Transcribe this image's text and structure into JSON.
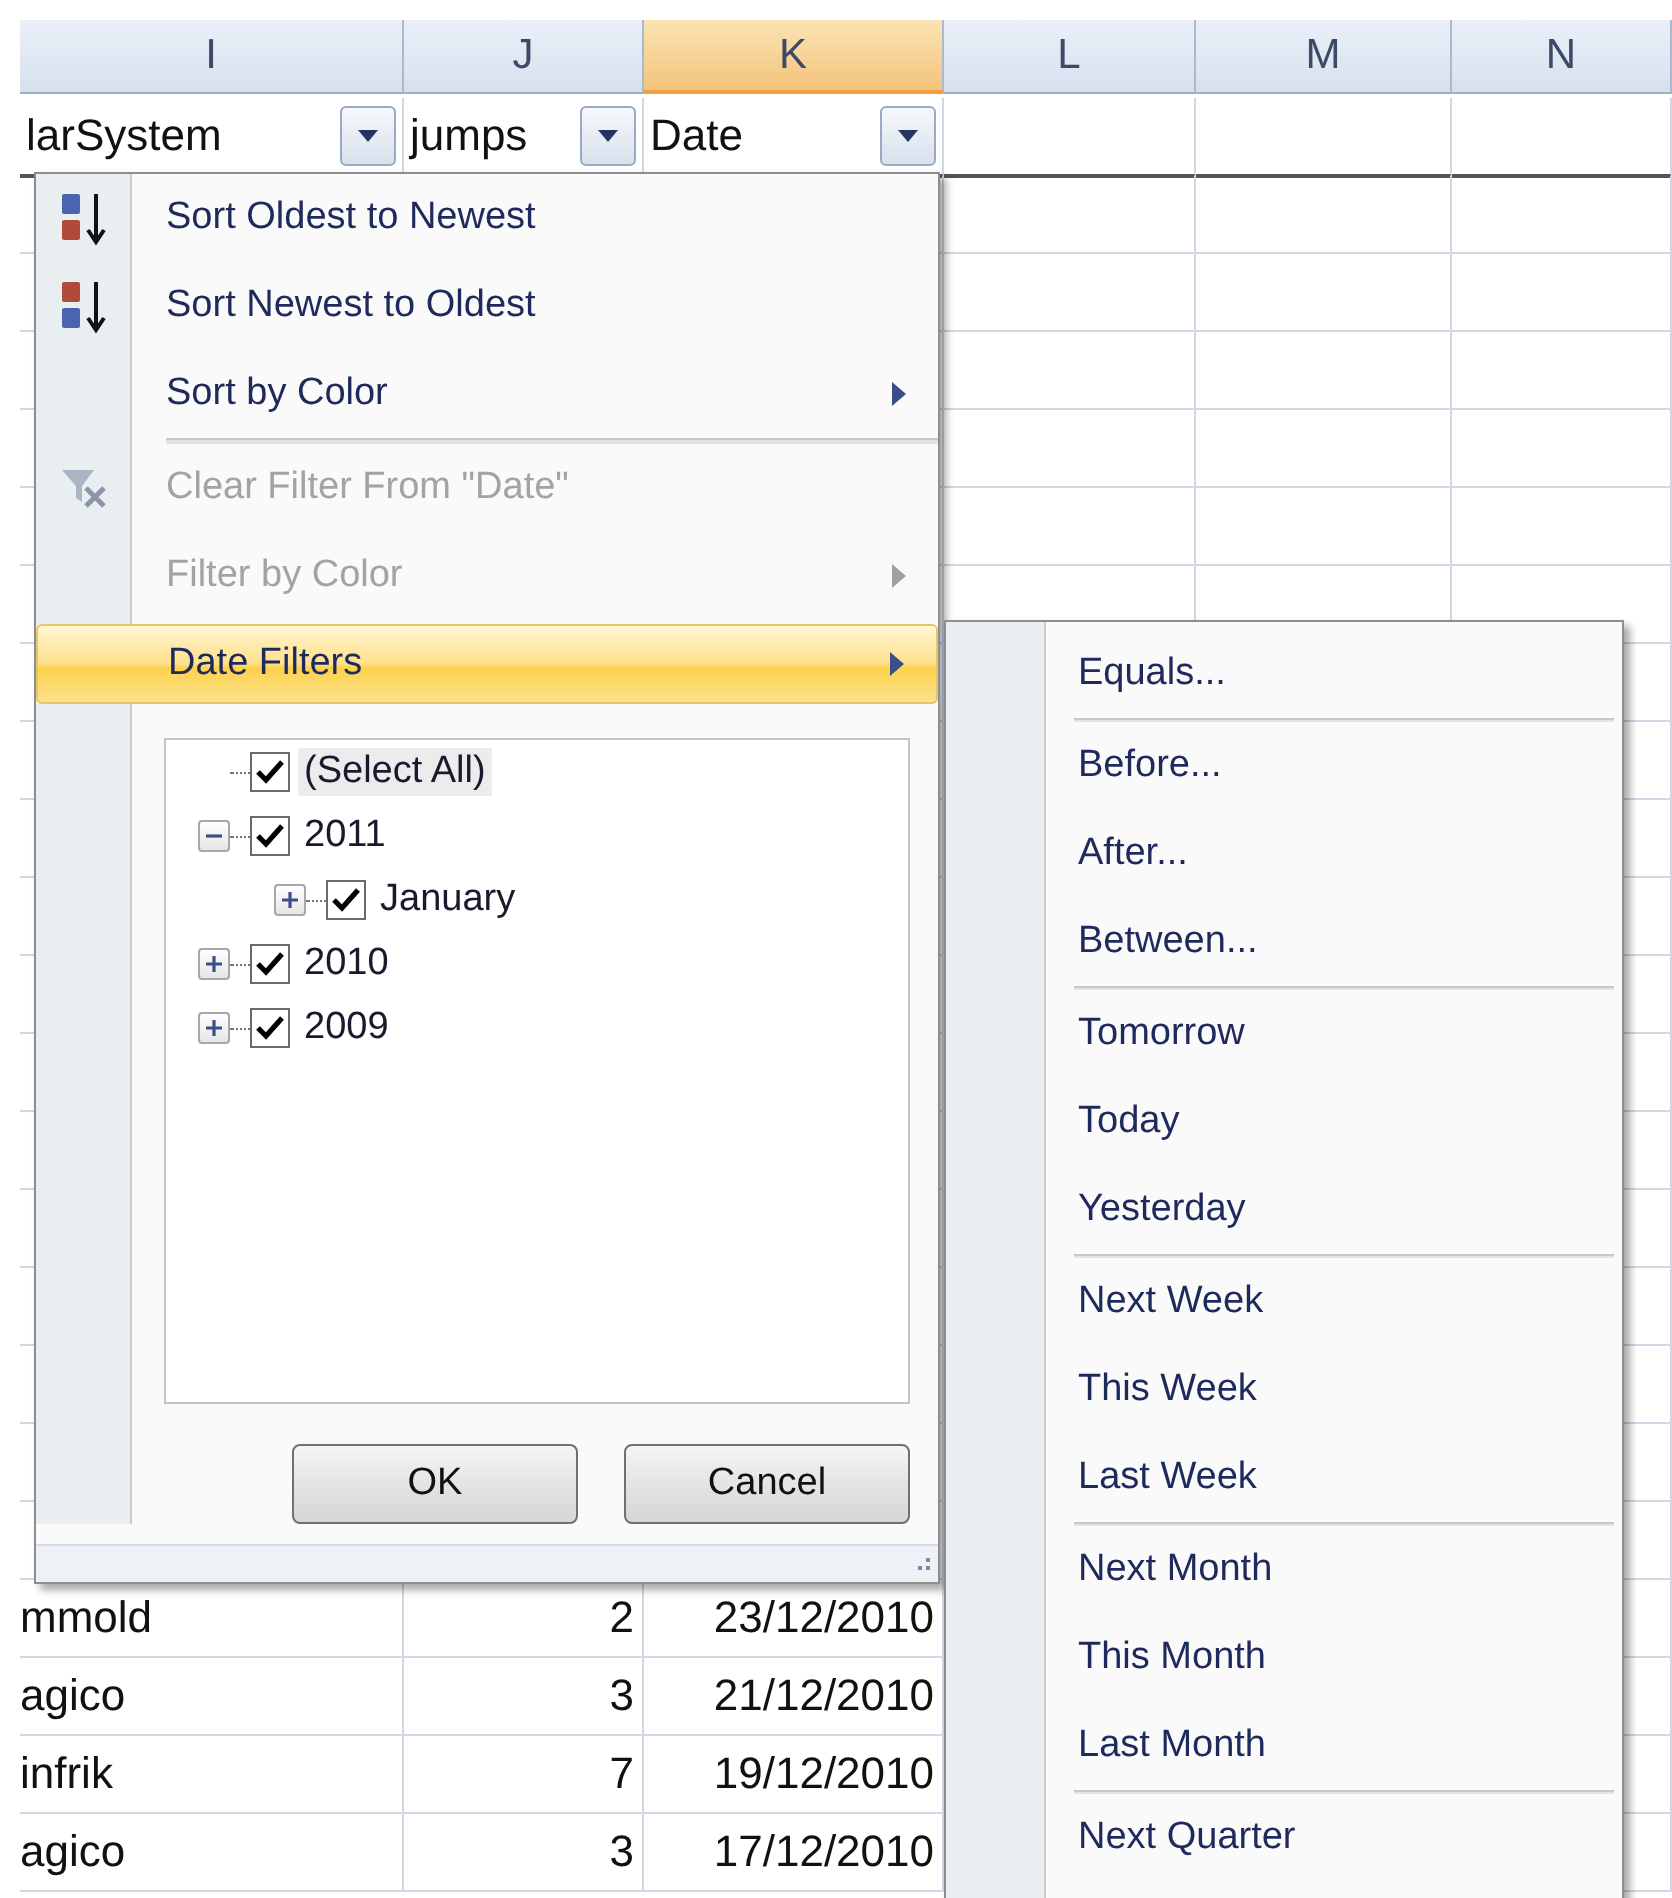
{
  "columns": [
    {
      "letter": "I",
      "selected": false
    },
    {
      "letter": "J",
      "selected": false
    },
    {
      "letter": "K",
      "selected": true
    },
    {
      "letter": "L",
      "selected": false
    },
    {
      "letter": "M",
      "selected": false
    },
    {
      "letter": "N",
      "selected": false
    }
  ],
  "header_row": [
    {
      "text": "larSystem",
      "filter": true
    },
    {
      "text": "jumps",
      "filter": true
    },
    {
      "text": "Date",
      "filter": true
    }
  ],
  "rows": [
    [
      "mmold",
      "2",
      "23/12/2010"
    ],
    [
      "agico",
      "3",
      "21/12/2010"
    ],
    [
      "infrik",
      "7",
      "19/12/2010"
    ],
    [
      "agico",
      "3",
      "17/12/2010"
    ]
  ],
  "filter_menu": {
    "items": [
      {
        "kind": "item",
        "label": "Sort Oldest to Newest",
        "disabled": false,
        "highlighted": false,
        "submenu": false
      },
      {
        "kind": "item",
        "label": "Sort Newest to Oldest",
        "disabled": false,
        "highlighted": false,
        "submenu": false
      },
      {
        "kind": "item",
        "label": "Sort by Color",
        "disabled": false,
        "highlighted": false,
        "submenu": true
      },
      {
        "kind": "separator"
      },
      {
        "kind": "item",
        "label": "Clear Filter From \"Date\"",
        "disabled": true,
        "highlighted": false,
        "submenu": false
      },
      {
        "kind": "item",
        "label": "Filter by Color",
        "disabled": true,
        "highlighted": false,
        "submenu": true
      },
      {
        "kind": "item",
        "label": "Date Filters",
        "disabled": false,
        "highlighted": true,
        "submenu": true
      }
    ],
    "select_all": {
      "label": "(Select All)",
      "checked": true
    },
    "tree": [
      {
        "label": "2011",
        "checked": true,
        "expanded": true,
        "children": [
          {
            "label": "January",
            "checked": true,
            "expanded": false
          }
        ]
      },
      {
        "label": "2010",
        "checked": true,
        "expanded": false
      },
      {
        "label": "2009",
        "checked": true,
        "expanded": false
      }
    ],
    "buttons": [
      "OK",
      "Cancel"
    ]
  },
  "date_filters_menu": {
    "items": [
      {
        "kind": "item",
        "label": "Equals..."
      },
      {
        "kind": "separator"
      },
      {
        "kind": "item",
        "label": "Before..."
      },
      {
        "kind": "item",
        "label": "After..."
      },
      {
        "kind": "item",
        "label": "Between..."
      },
      {
        "kind": "separator"
      },
      {
        "kind": "item",
        "label": "Tomorrow"
      },
      {
        "kind": "item",
        "label": "Today"
      },
      {
        "kind": "item",
        "label": "Yesterday"
      },
      {
        "kind": "separator"
      },
      {
        "kind": "item",
        "label": "Next Week"
      },
      {
        "kind": "item",
        "label": "This Week"
      },
      {
        "kind": "item",
        "label": "Last Week"
      },
      {
        "kind": "separator"
      },
      {
        "kind": "item",
        "label": "Next Month"
      },
      {
        "kind": "item",
        "label": "This Month"
      },
      {
        "kind": "item",
        "label": "Last Month"
      },
      {
        "kind": "separator"
      },
      {
        "kind": "item",
        "label": "Next Quarter"
      }
    ]
  }
}
